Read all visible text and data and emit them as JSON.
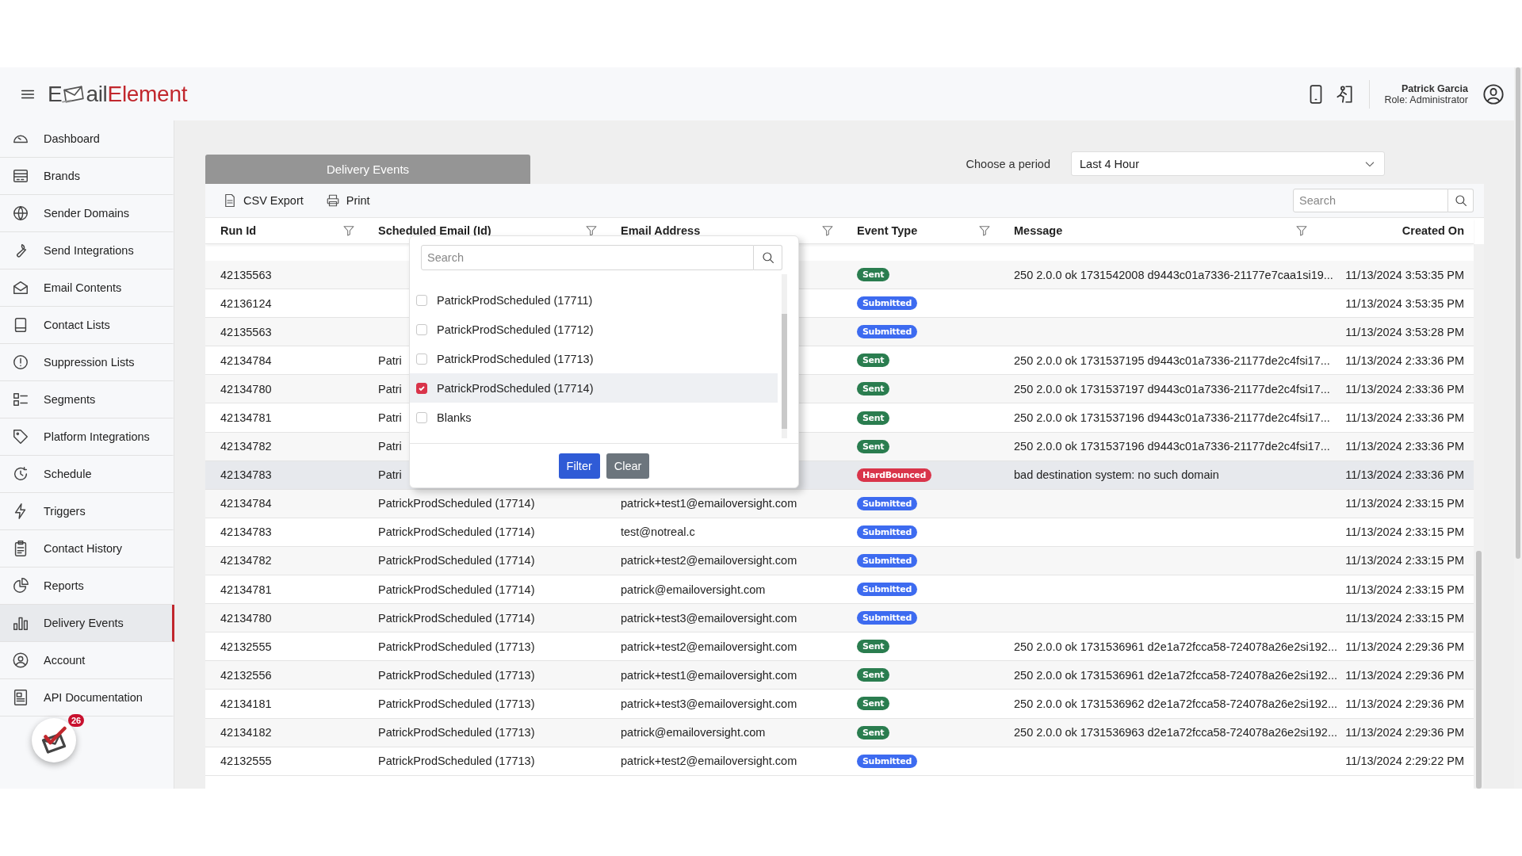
{
  "header": {
    "logo": {
      "lead": "E",
      "rest": "ail",
      "accent": "Element"
    },
    "user": {
      "name": "Patrick Garcia",
      "role": "Role: Administrator"
    }
  },
  "sidebar": {
    "items": [
      {
        "label": "Dashboard",
        "selected": false
      },
      {
        "label": "Brands",
        "selected": false
      },
      {
        "label": "Sender Domains",
        "selected": false
      },
      {
        "label": "Send Integrations",
        "selected": false
      },
      {
        "label": "Email Contents",
        "selected": false
      },
      {
        "label": "Contact Lists",
        "selected": false
      },
      {
        "label": "Suppression Lists",
        "selected": false
      },
      {
        "label": "Segments",
        "selected": false
      },
      {
        "label": "Platform Integrations",
        "selected": false
      },
      {
        "label": "Schedule",
        "selected": false
      },
      {
        "label": "Triggers",
        "selected": false
      },
      {
        "label": "Contact History",
        "selected": false
      },
      {
        "label": "Reports",
        "selected": false
      },
      {
        "label": "Delivery Events",
        "selected": true
      },
      {
        "label": "Account",
        "selected": false
      },
      {
        "label": "API Documentation",
        "selected": false
      }
    ],
    "notification_count": "26"
  },
  "page": {
    "tab": "Delivery Events",
    "period_label": "Choose a period",
    "period_value": "Last 4 Hour"
  },
  "toolbar": {
    "buttons": [
      "CSV Export",
      "Print"
    ],
    "search": {
      "placeholder": "Search"
    }
  },
  "table": {
    "columns": [
      {
        "label": "Run Id",
        "filter": true
      },
      {
        "label": "Scheduled Email (Id)",
        "filter": true
      },
      {
        "label": "Email Address",
        "filter": true
      },
      {
        "label": "Event Type",
        "filter": true
      },
      {
        "label": "Message",
        "filter": true
      },
      {
        "label": "Created On",
        "filter": false
      }
    ],
    "rows": [
      {
        "run_id": "42135563",
        "event": {
          "label": "Sent",
          "color": "#2a7d4f"
        },
        "message": "250 2.0.0 ok 1731542008 d9443c01a7336-21177e7caa1si19...",
        "created_on": "11/13/2024 3:53:35 PM",
        "selected": false
      },
      {
        "run_id": "42136124",
        "event": {
          "label": "Submitted",
          "color": "#3d6bf0"
        },
        "created_on": "11/13/2024 3:53:35 PM",
        "selected": false
      },
      {
        "run_id": "42135563",
        "event": {
          "label": "Submitted",
          "color": "#3d6bf0"
        },
        "created_on": "11/13/2024 3:53:28 PM",
        "selected": false
      },
      {
        "run_id": "42134784",
        "scheduled_email": "Patri",
        "event": {
          "label": "Sent",
          "color": "#2a7d4f"
        },
        "message": "250 2.0.0 ok 1731537195 d9443c01a7336-21177de2c4fsi17...",
        "created_on": "11/13/2024 2:33:36 PM",
        "selected": false
      },
      {
        "run_id": "42134780",
        "scheduled_email": "Patri",
        "event": {
          "label": "Sent",
          "color": "#2a7d4f"
        },
        "message": "250 2.0.0 ok 1731537197 d9443c01a7336-21177de2c4fsi17...",
        "created_on": "11/13/2024 2:33:36 PM",
        "selected": false
      },
      {
        "run_id": "42134781",
        "scheduled_email": "Patri",
        "event": {
          "label": "Sent",
          "color": "#2a7d4f"
        },
        "message": "250 2.0.0 ok 1731537196 d9443c01a7336-21177de2c4fsi17...",
        "created_on": "11/13/2024 2:33:36 PM",
        "selected": false
      },
      {
        "run_id": "42134782",
        "scheduled_email": "Patri",
        "event": {
          "label": "Sent",
          "color": "#2a7d4f"
        },
        "message": "250 2.0.0 ok 1731537196 d9443c01a7336-21177de2c4fsi17...",
        "created_on": "11/13/2024 2:33:36 PM",
        "selected": false
      },
      {
        "run_id": "42134783",
        "scheduled_email": "Patri",
        "event": {
          "label": "HardBounced",
          "color": "#d9344a"
        },
        "message": "bad destination system: no such domain",
        "created_on": "11/13/2024 2:33:36 PM",
        "selected": true
      },
      {
        "run_id": "42134784",
        "scheduled_email": "PatrickProdScheduled (17714)",
        "email": "patrick+test1@emailoversight.com",
        "event": {
          "label": "Submitted",
          "color": "#3d6bf0"
        },
        "created_on": "11/13/2024 2:33:15 PM",
        "selected": false
      },
      {
        "run_id": "42134783",
        "scheduled_email": "PatrickProdScheduled (17714)",
        "email": "test@notreal.c",
        "event": {
          "label": "Submitted",
          "color": "#3d6bf0"
        },
        "created_on": "11/13/2024 2:33:15 PM",
        "selected": false
      },
      {
        "run_id": "42134782",
        "scheduled_email": "PatrickProdScheduled (17714)",
        "email": "patrick+test2@emailoversight.com",
        "event": {
          "label": "Submitted",
          "color": "#3d6bf0"
        },
        "created_on": "11/13/2024 2:33:15 PM",
        "selected": false
      },
      {
        "run_id": "42134781",
        "scheduled_email": "PatrickProdScheduled (17714)",
        "email": "patrick@emailoversight.com",
        "event": {
          "label": "Submitted",
          "color": "#3d6bf0"
        },
        "created_on": "11/13/2024 2:33:15 PM",
        "selected": false
      },
      {
        "run_id": "42134780",
        "scheduled_email": "PatrickProdScheduled (17714)",
        "email": "patrick+test3@emailoversight.com",
        "event": {
          "label": "Submitted",
          "color": "#3d6bf0"
        },
        "created_on": "11/13/2024 2:33:15 PM",
        "selected": false
      },
      {
        "run_id": "42132555",
        "scheduled_email": "PatrickProdScheduled (17713)",
        "email": "patrick+test2@emailoversight.com",
        "event": {
          "label": "Sent",
          "color": "#2a7d4f"
        },
        "message": "250 2.0.0 ok 1731536961 d2e1a72fcca58-724078a26e2si192...",
        "created_on": "11/13/2024 2:29:36 PM",
        "selected": false
      },
      {
        "run_id": "42132556",
        "scheduled_email": "PatrickProdScheduled (17713)",
        "email": "patrick+test1@emailoversight.com",
        "event": {
          "label": "Sent",
          "color": "#2a7d4f"
        },
        "message": "250 2.0.0 ok 1731536961 d2e1a72fcca58-724078a26e2si192...",
        "created_on": "11/13/2024 2:29:36 PM",
        "selected": false
      },
      {
        "run_id": "42134181",
        "scheduled_email": "PatrickProdScheduled (17713)",
        "email": "patrick+test3@emailoversight.com",
        "event": {
          "label": "Sent",
          "color": "#2a7d4f"
        },
        "message": "250 2.0.0 ok 1731536962 d2e1a72fcca58-724078a26e2si192...",
        "created_on": "11/13/2024 2:29:36 PM",
        "selected": false
      },
      {
        "run_id": "42134182",
        "scheduled_email": "PatrickProdScheduled (17713)",
        "email": "patrick@emailoversight.com",
        "event": {
          "label": "Sent",
          "color": "#2a7d4f"
        },
        "message": "250 2.0.0 ok 1731536963 d2e1a72fcca58-724078a26e2si192...",
        "created_on": "11/13/2024 2:29:36 PM",
        "selected": false
      },
      {
        "run_id": "42132555",
        "scheduled_email": "PatrickProdScheduled (17713)",
        "email": "patrick+test2@emailoversight.com",
        "event": {
          "label": "Submitted",
          "color": "#3d6bf0"
        },
        "created_on": "11/13/2024 2:29:22 PM",
        "selected": false
      }
    ]
  },
  "filter_popup": {
    "search": {
      "placeholder": "Search"
    },
    "options": [
      {
        "label": "PatrickProdScheduled (17711)",
        "checked": false,
        "selected": false
      },
      {
        "label": "PatrickProdScheduled (17712)",
        "checked": false,
        "selected": false
      },
      {
        "label": "PatrickProdScheduled (17713)",
        "checked": false,
        "selected": false
      },
      {
        "label": "PatrickProdScheduled (17714)",
        "checked": true,
        "selected": true
      },
      {
        "label": "Blanks",
        "checked": false,
        "selected": false
      }
    ],
    "buttons": [
      "Filter",
      "Clear"
    ]
  }
}
